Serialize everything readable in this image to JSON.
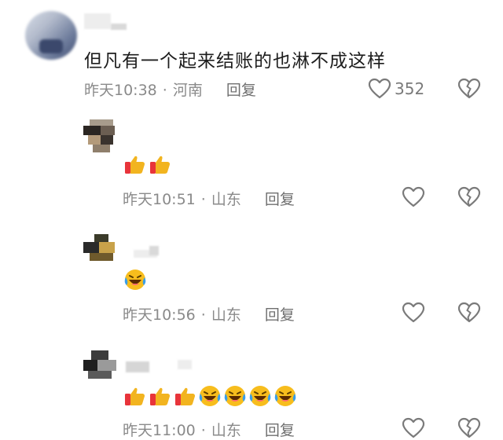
{
  "main_comment": {
    "text": "但凡有一个起来结账的也淋不成这样",
    "time": "昨天10:38",
    "location": "河南",
    "reply_label": "回复",
    "like_count": "352"
  },
  "replies": [
    {
      "time": "昨天10:51",
      "location": "山东",
      "reply_label": "回复",
      "emojis": [
        "thumbs-up",
        "thumbs-up"
      ]
    },
    {
      "time": "昨天10:56",
      "location": "山东",
      "reply_label": "回复",
      "emojis": [
        "laughing-tears"
      ]
    },
    {
      "time": "昨天11:00",
      "location": "山东",
      "reply_label": "回复",
      "emojis": [
        "thumbs-up",
        "thumbs-up",
        "thumbs-up",
        "laughing-tears",
        "laughing-tears",
        "laughing-tears",
        "laughing-tears"
      ]
    }
  ],
  "separator": "·",
  "icons": {
    "like": "heart-outline-icon",
    "dislike": "broken-heart-icon",
    "thumbs_up": "thumbs-up-emoji",
    "laughing": "laughing-tears-emoji"
  },
  "colors": {
    "meta_text": "#8a8a8a",
    "thumb_up": "#f2b41f",
    "cuff": "#e8343a",
    "laugh_face": "#f7bd1d",
    "tears": "#3a9ee8"
  }
}
